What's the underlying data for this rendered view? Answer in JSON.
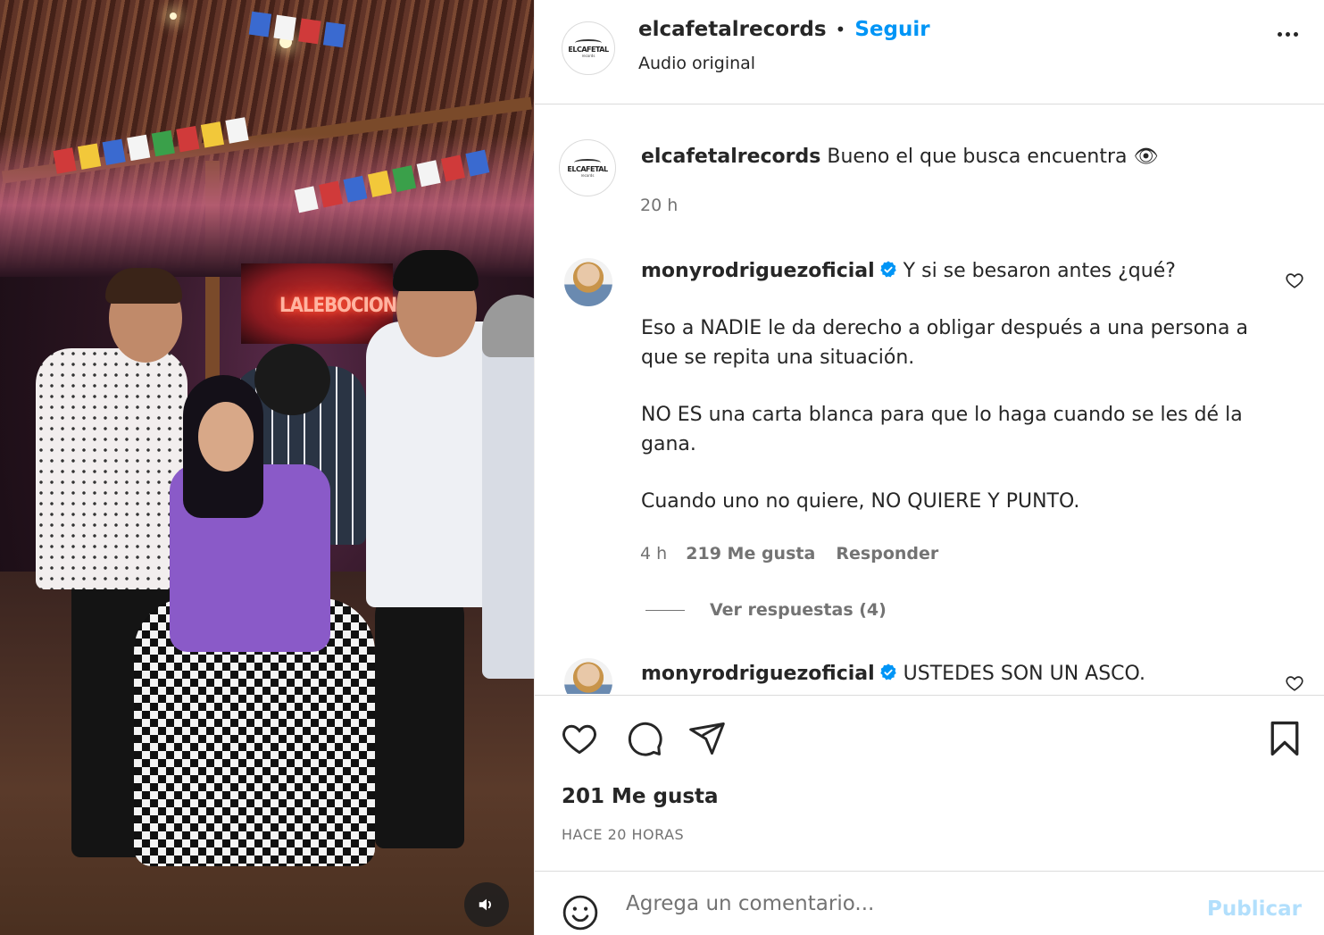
{
  "post": {
    "username": "elcafetalrecords",
    "separator": "•",
    "follow_label": "Seguir",
    "audio_label": "Audio original",
    "logo_text": "ELCAFETAL",
    "logo_subtext": "records"
  },
  "media": {
    "neon_sign": "LALEBOCION",
    "sound_icon": "speaker-icon"
  },
  "caption": {
    "username": "elcafetalrecords",
    "text": "Bueno el que busca encuentra 👁",
    "time": "20 h"
  },
  "comments": [
    {
      "username": "monyrodriguezoficial",
      "verified": true,
      "first_line": "Y si se besaron antes ¿qué?",
      "paragraphs": [
        "Eso a NADIE le da derecho a obligar después a una persona a que se repita una situación.",
        "NO ES una carta blanca para que lo haga cuando se les dé la gana.",
        "Cuando uno no quiere, NO QUIERE Y PUNTO."
      ],
      "time": "4 h",
      "likes": "219 Me gusta",
      "reply_label": "Responder",
      "view_replies": "Ver respuestas (4)"
    },
    {
      "username": "monyrodriguezoficial",
      "verified": true,
      "first_line": "USTEDES SON UN ASCO."
    }
  ],
  "actions": {
    "likes": "201 Me gusta",
    "time_ago": "HACE 20 HORAS"
  },
  "composer": {
    "placeholder": "Agrega un comentario...",
    "publish_label": "Publicar"
  },
  "colors": {
    "accent": "#0095f6",
    "verified": "#0095f6",
    "publish_disabled": "#b2dffc",
    "secondary_text": "#737373"
  }
}
